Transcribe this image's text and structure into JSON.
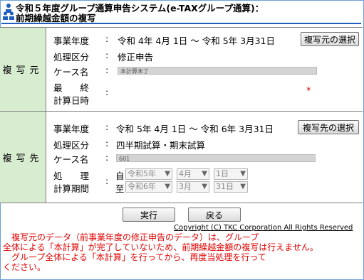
{
  "header": {
    "title_line1": "令和５年度グループ通算申告システム(e-TAXグループ通算)：",
    "title_line2": "前期繰越金額の複写"
  },
  "source": {
    "side_label": "複写元",
    "fiscal_year_label": "事業年度",
    "fiscal_year_value": "令和 4年 4月 1日 ～ 令和 5年 3月31日",
    "select_button": "複写元の選択",
    "processing_label": "処理区分",
    "processing_value": "修正申告",
    "case_label": "ケース名",
    "case_value": "本計算未了",
    "last_calc_label1": "最　　終",
    "last_calc_label2": "計算日時",
    "last_calc_value": "",
    "required_mark": "*"
  },
  "destination": {
    "side_label": "複写先",
    "fiscal_year_label": "事業年度",
    "fiscal_year_value": "令和 5年 4月 1日 ～ 令和 6年 3月31日",
    "select_button": "複写先の選択",
    "processing_label": "処理区分",
    "processing_value": "四半期試算・期末試算",
    "case_label": "ケース名",
    "case_value": "601",
    "period_label1": "処　　理",
    "period_label2": "計算期間",
    "from_label": "自",
    "to_label": "至",
    "from": {
      "year": "令和5年",
      "month": "4月",
      "day": "1日"
    },
    "to": {
      "year": "令和6年",
      "month": "3月",
      "day": "31日"
    }
  },
  "buttons": {
    "execute": "実行",
    "back": "戻る"
  },
  "copyright": "Copyright (C) TKC Corporation All Rights Reserved",
  "message": {
    "line1": "　複写元のデータ（前事業年度の修正申告のデータ）は、グループ",
    "line2": "全体による「本計算」が完了していないため、前期繰越金額の複写は行えません。",
    "line3": "　グループ全体による「本計算」を行ってから、再度当処理を行って",
    "line4": "ください。"
  },
  "colors": {
    "accent": "#1f5fbf",
    "side_bg": "#d8ecd0",
    "error": "#e00000"
  },
  "icons": {
    "title": "group-people-icon",
    "dropdown": "chevron-down-icon"
  }
}
